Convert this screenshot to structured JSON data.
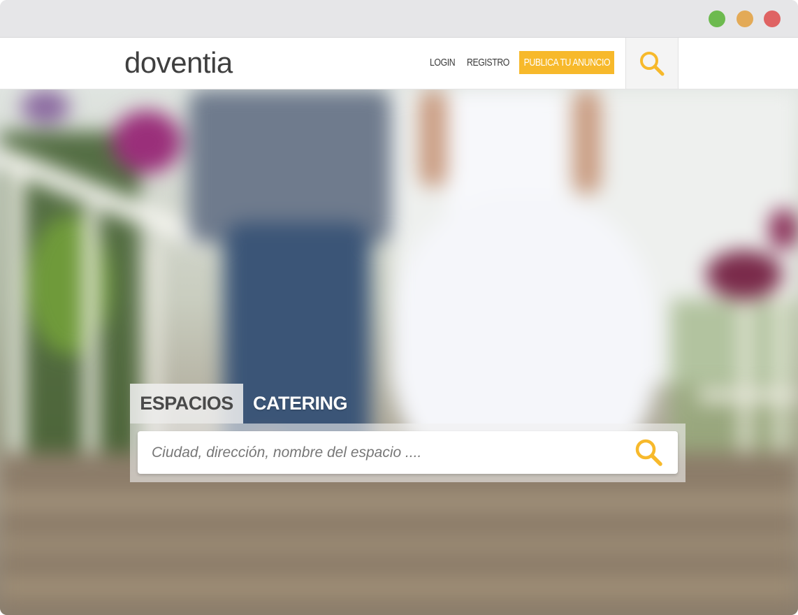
{
  "browser": {
    "controls": [
      "green",
      "orange",
      "red"
    ],
    "colors": {
      "green": "#6dba4f",
      "orange": "#e3aa57",
      "red": "#df6363"
    }
  },
  "header": {
    "logo": "doventia",
    "nav": {
      "login": "LOGIN",
      "registro": "REGISTRO"
    },
    "cta_label": "PUBLICA TU ANUNCIO",
    "search_icon": "search-icon"
  },
  "hero": {
    "background": "blurred photo of a wedding couple walking on a wooden bridge",
    "tabs": [
      {
        "label": "ESPACIOS",
        "active": true
      },
      {
        "label": "CATERING",
        "active": false
      }
    ],
    "search": {
      "placeholder": "Ciudad, dirección, nombre del espacio ....",
      "value": ""
    }
  },
  "colors": {
    "accent": "#f7b92b",
    "logo": "#3f3f3f"
  }
}
